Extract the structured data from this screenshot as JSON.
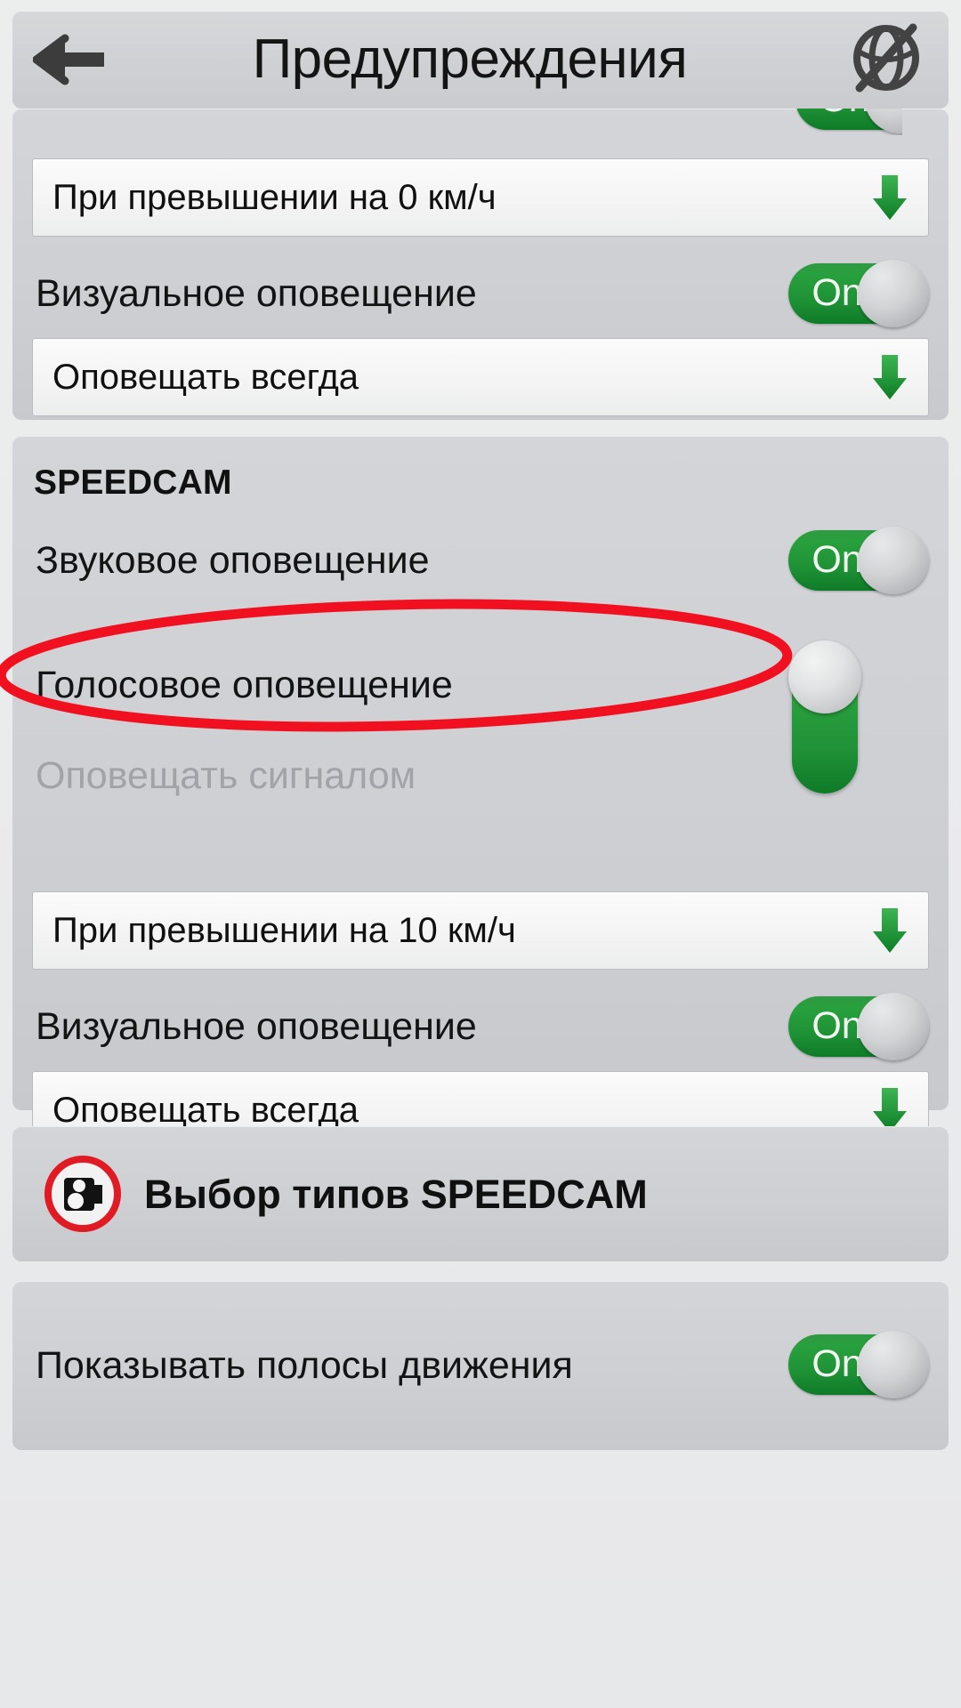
{
  "header": {
    "title": "Предупреждения",
    "back_icon": "arrow-left-icon",
    "right_icon": "globe-crossed-icon"
  },
  "sections": [
    {
      "id": "top-section",
      "header": "",
      "rows": [
        {
          "type": "toggle",
          "label": "",
          "value": "On",
          "partial": true
        },
        {
          "type": "dropdown",
          "value": "При превышении на 0 км/ч"
        },
        {
          "type": "toggle",
          "label": "Визуальное оповещение",
          "value": "On"
        },
        {
          "type": "dropdown",
          "value": "Оповещать всегда"
        }
      ]
    },
    {
      "id": "speedcam-section",
      "header": "SPEEDCAM",
      "rows": [
        {
          "type": "toggle",
          "label": "Звуковое оповещение",
          "value": "On"
        },
        {
          "type": "toggle-vertical",
          "label": "Голосовое оповещение",
          "value": "On"
        },
        {
          "type": "label-disabled",
          "label": "Оповещать сигналом"
        },
        {
          "type": "dropdown",
          "value": "При превышении на 10 км/ч"
        },
        {
          "type": "toggle",
          "label": "Визуальное оповещение",
          "value": "On"
        },
        {
          "type": "dropdown",
          "value": "Оповещать всегда"
        }
      ]
    },
    {
      "id": "speedcam-types-section",
      "rows": [
        {
          "type": "icon-link",
          "icon": "speedcam-sign-icon",
          "label": "Выбор типов SPEEDCAM"
        }
      ]
    },
    {
      "id": "lanes-section",
      "rows": [
        {
          "type": "toggle",
          "label": "Показывать полосы движения",
          "value": "On"
        }
      ]
    }
  ],
  "annotation": {
    "type": "ellipse",
    "color": "#F01020",
    "target": "Голосовое оповещение"
  },
  "colors": {
    "toggle_on_green": "#1f9236",
    "annotation_red": "#F01020",
    "arrow_green": "#2aa03c",
    "card_bg": "#cdcfd3",
    "page_bg": "#e9eaec",
    "text": "#131313",
    "text_disabled": "#a0a3a7"
  }
}
